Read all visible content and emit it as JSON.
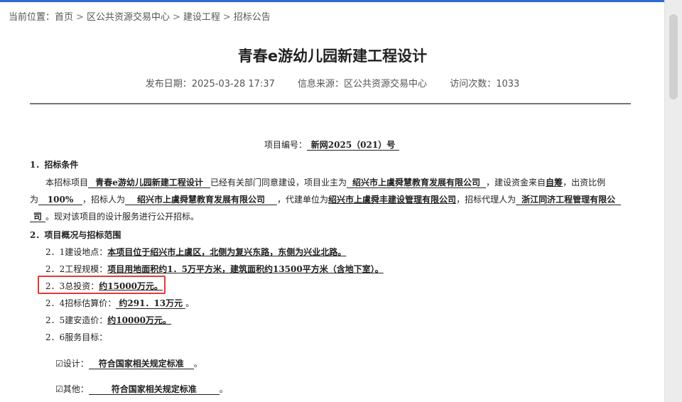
{
  "breadcrumb": {
    "prefix": "当前位置：",
    "items": [
      "首页",
      "区公共资源交易中心",
      "建设工程",
      "招标公告"
    ],
    "separator": ">"
  },
  "article": {
    "title": "青春e游幼儿园新建工程设计",
    "publish_label": "发布日期：",
    "publish_date": "2025-03-28 17:37",
    "source_label": "信息来源：",
    "source": "区公共资源交易中心",
    "visits_label": "访问次数：",
    "visits": "1033"
  },
  "doc": {
    "project_no_label": "项目编号：",
    "project_no": "新网2025（021）号",
    "s1_title": "1．招标条件",
    "s1_p1_a": "本招标项目",
    "s1_project": "青春e游幼儿园新建工程设计",
    "s1_p1_b": "已经有关部门同意建设，项目业主为",
    "s1_owner": "绍兴市上虞舜慧教育发展有限公司",
    "s1_p1_c": "，建设资金来自",
    "s1_fund": "自筹",
    "s1_p1_d": "，出资比例",
    "s1_p2_a": "为",
    "s1_ratio": "100%",
    "s1_p2_b": "，招标人为",
    "s1_tenderer": "绍兴市上虞舜慧教育发展有限公司",
    "s1_p2_c": "，代建单位为",
    "s1_agent_builder": "绍兴市上虞舜丰建设管理有限公司",
    "s1_p2_d": "，招标代理人为",
    "s1_agent": "浙江同济工程管理有限公",
    "s1_agent_tail": "司",
    "s1_p3": "。现对该项目的设计服务进行公开招标。",
    "s2_title": "2．项目概况与招标范围",
    "s2_1_label": "2．1建设地点：",
    "s2_1_value": "本项目位于绍兴市上虞区，北侧为复兴东路，东侧为兴业北路。",
    "s2_2_label": "2．2工程规模：",
    "s2_2_value": "项目用地面积约1．5万平方米，建筑面积约13500平方米（含地下室）。",
    "s2_3_label": "2．3总投资：",
    "s2_3_value": "约15000万元。",
    "s2_4_label": "2．4招标估算价：",
    "s2_4_value": "约291．13万元",
    "s2_4_tail": "。",
    "s2_5_label": "2．5建安造价：",
    "s2_5_value": "约10000万元。",
    "s2_6_label": "2．6服务目标：",
    "goal_design_label": "☑设计：",
    "goal_design_value": "符合国家相关规定标准",
    "goal_other_label": "☑其他：",
    "goal_other_value": "符合国家相关规定标准",
    "period": "。"
  },
  "colors": {
    "accent": "#2d6bd3",
    "highlight_border": "#e53935"
  }
}
